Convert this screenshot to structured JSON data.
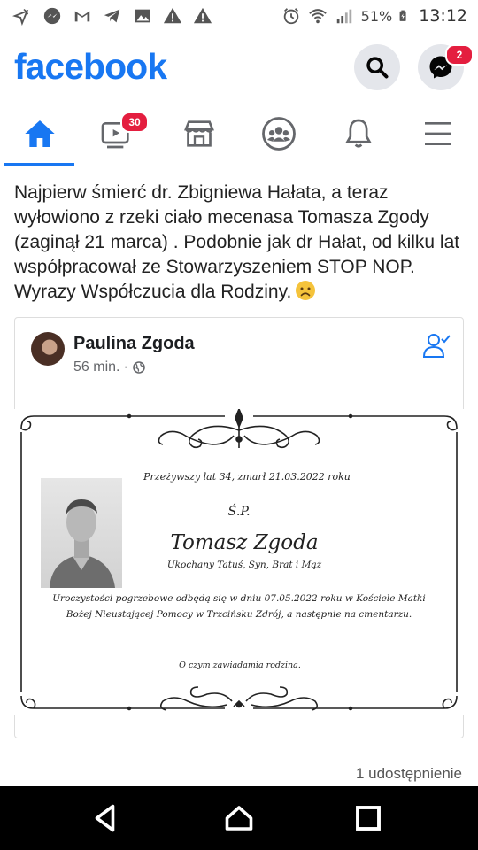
{
  "status_bar": {
    "battery_percent": "51%",
    "time": "13:12",
    "left_icons": [
      "cursor-icon",
      "messenger-icon",
      "gmail-icon",
      "telegram-icon",
      "gallery-icon",
      "warning-icon",
      "warning-icon"
    ],
    "right_icons": [
      "alarm-icon",
      "wifi-icon",
      "signal-icon",
      "battery-icon"
    ]
  },
  "header": {
    "logo": "facebook",
    "messenger_badge": "2"
  },
  "nav": {
    "tabs": [
      "home",
      "video",
      "marketplace",
      "groups",
      "notifications",
      "menu"
    ],
    "video_badge": "30",
    "active_tab": "home"
  },
  "post": {
    "text": "Najpierw śmierć dr. Zbigniewa Hałata, a teraz wyłowiono z rzeki ciało mecenasa Tomasza Zgody (zaginął 21 marca) . Podobnie jak dr Hałat, od kilku lat współpracował ze Stowarzyszeniem STOP NOP. Wyrazy Współczucia dla Rodziny."
  },
  "shared_post": {
    "author": "Paulina Zgoda",
    "time": "56 min.",
    "separator": "·"
  },
  "obituary": {
    "age_line": "Przeżywszy lat 34, zmarł 21.03.2022 roku",
    "sp": "Ś.P.",
    "name": "Tomasz Zgoda",
    "relations": "Ukochany Tatuś, Syn, Brat i Mąż",
    "funeral_line1": "Uroczystości pogrzebowe odbędą się w dniu 07.05.2022 roku w Kościele Matki",
    "funeral_line2": "Bożej Nieustającej Pomocy w Trzcińsku Zdrój, a następnie na cmentarzu.",
    "notice": "O czym zawiadamia rodzina."
  },
  "footer": {
    "shares": "1 udostępnienie"
  },
  "colors": {
    "brand": "#1877f2",
    "badge": "#e41e3f"
  }
}
